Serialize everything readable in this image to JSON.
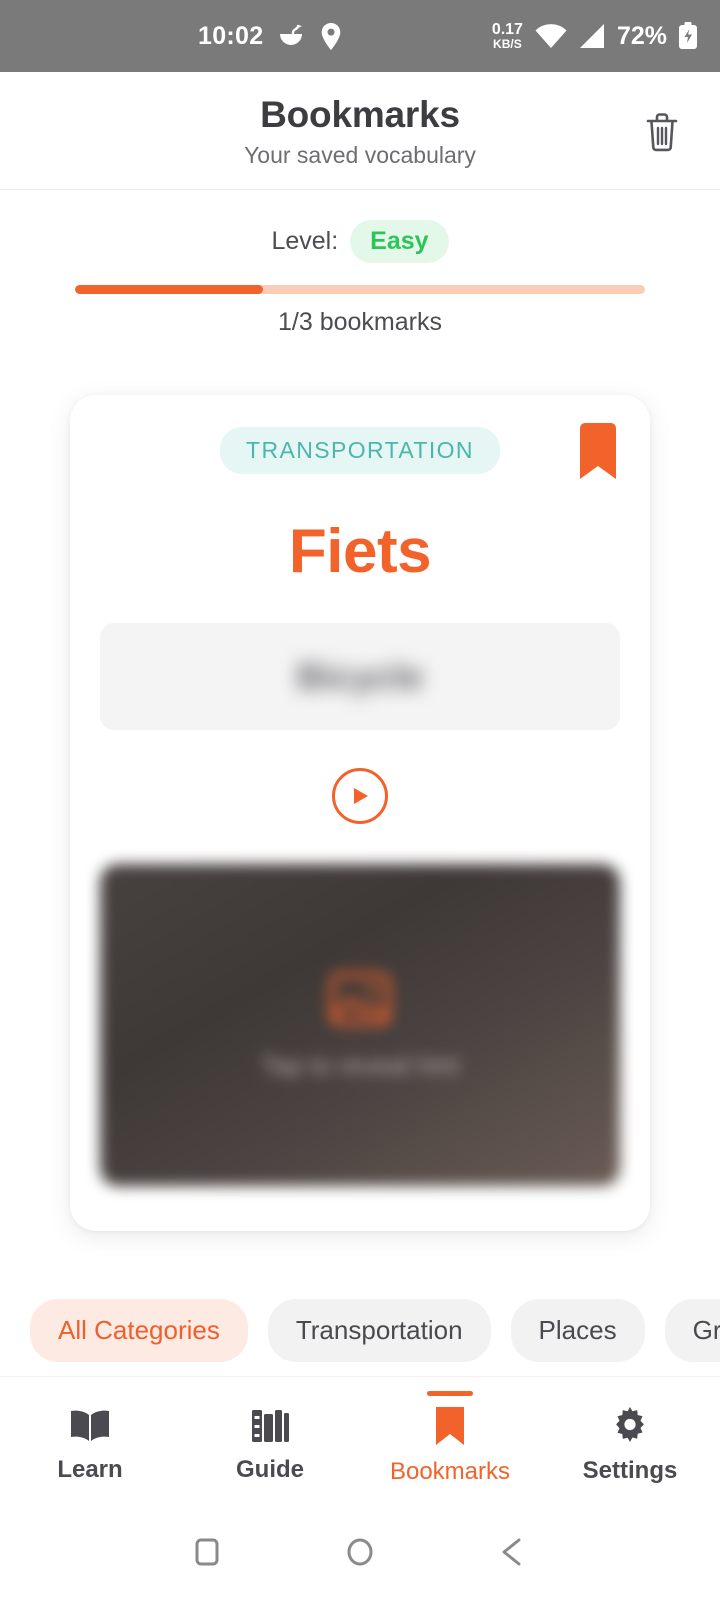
{
  "statusbar": {
    "time": "10:02",
    "net_speed_value": "0.17",
    "net_speed_unit": "KB/S",
    "battery_percent": "72%",
    "icons": [
      "food-bowl-icon",
      "location-pin-icon",
      "wifi-icon",
      "cellular-signal-icon",
      "battery-charging-icon"
    ]
  },
  "header": {
    "title": "Bookmarks",
    "subtitle": "Your saved vocabulary",
    "delete_icon": "trash-icon"
  },
  "level": {
    "label": "Level:",
    "value": "Easy",
    "badge_color": "#2ec45c",
    "badge_bg": "#e3f8e8",
    "progress_percent": 33,
    "progress_fill_color": "#f2622b",
    "progress_track_color": "#fbcdb6",
    "caption": "1/3 bookmarks"
  },
  "card": {
    "category": "TRANSPORTATION",
    "category_color": "#4cb6aa",
    "category_bg": "#e6f6f4",
    "word": "Fiets",
    "word_color": "#f2622b",
    "translation": "Bicycle",
    "translation_hidden": true,
    "bookmark_icon": "bookmark-filled-icon",
    "play_icon": "play-audio-icon",
    "hint": {
      "image_icon": "image-placeholder-icon",
      "text": "Tap to reveal hint",
      "blurred": true
    }
  },
  "filters": {
    "chips": [
      {
        "label": "All Categories",
        "active": true
      },
      {
        "label": "Transportation",
        "active": false
      },
      {
        "label": "Places",
        "active": false
      },
      {
        "label": "Gr",
        "active": false
      }
    ]
  },
  "bottom_nav": {
    "items": [
      {
        "label": "Learn",
        "icon": "open-book-icon",
        "active": false
      },
      {
        "label": "Guide",
        "icon": "library-books-icon",
        "active": false
      },
      {
        "label": "Bookmarks",
        "icon": "bookmark-icon",
        "active": true
      },
      {
        "label": "Settings",
        "icon": "gear-icon",
        "active": false
      }
    ],
    "active_color": "#f2622b"
  },
  "android_nav": {
    "recents": "square-recents-icon",
    "home": "circle-home-icon",
    "back": "triangle-back-icon"
  }
}
